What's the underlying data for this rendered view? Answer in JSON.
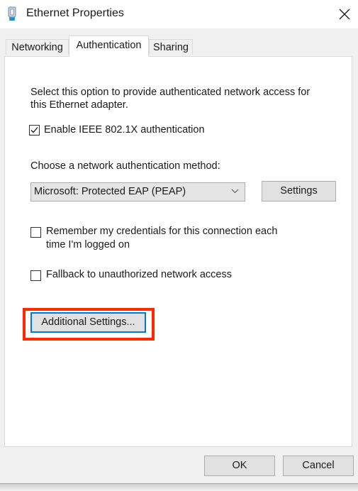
{
  "window": {
    "title": "Ethernet Properties",
    "icon": "ethernet-adapter-icon",
    "close_icon": "close-icon"
  },
  "tabs": [
    {
      "label": "Networking",
      "active": false
    },
    {
      "label": "Authentication",
      "active": true
    },
    {
      "label": "Sharing",
      "active": false
    }
  ],
  "authentication": {
    "description_line1": "Select this option to provide authenticated network access for",
    "description_line2": "this Ethernet adapter.",
    "enable_8021x": {
      "label": "Enable IEEE 802.1X authentication",
      "checked": true
    },
    "method_label": "Choose a network authentication method:",
    "method_select": {
      "value": "Microsoft: Protected EAP (PEAP)"
    },
    "settings_button": "Settings",
    "remember_credentials": {
      "label_line1": "Remember my credentials for this connection each",
      "label_line2": "time I'm logged on",
      "checked": false
    },
    "fallback": {
      "label": "Fallback to unauthorized network access",
      "checked": false
    },
    "additional_settings_button": "Additional Settings..."
  },
  "footer": {
    "ok_button": "OK",
    "cancel_button": "Cancel"
  },
  "annotation": {
    "highlight_color": "#ff2a00",
    "target": "additional-settings-button"
  }
}
